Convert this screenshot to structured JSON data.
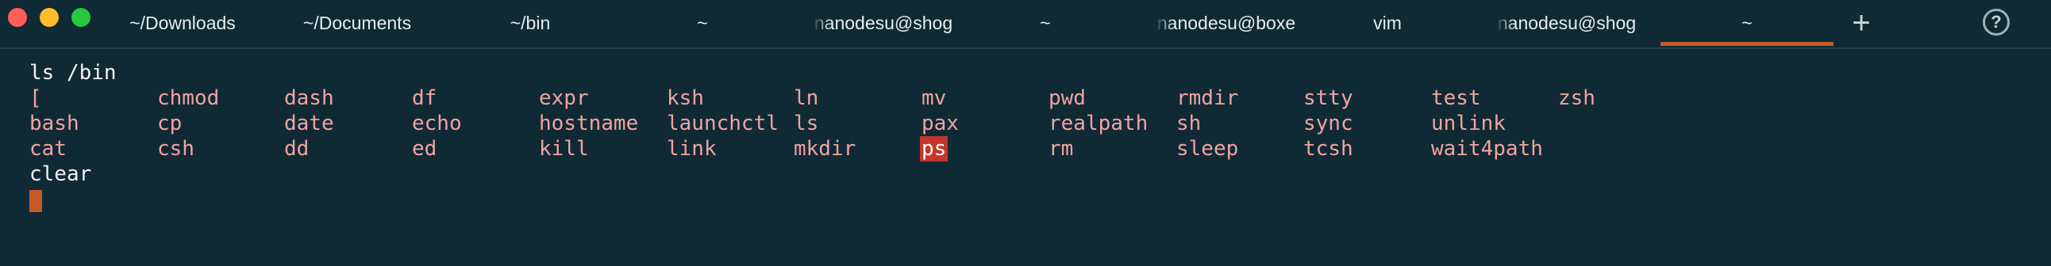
{
  "window": {
    "tabs": [
      {
        "label": "~/Downloads",
        "active": false
      },
      {
        "label": "~/Documents",
        "active": false
      },
      {
        "label": "~/bin",
        "active": false
      },
      {
        "label": "~",
        "active": false
      },
      {
        "label": "nanodesu@shog",
        "active": false
      },
      {
        "label": "~",
        "active": false
      },
      {
        "label": "nanodesu@boxe",
        "active": false
      },
      {
        "label": "vim",
        "active": false
      },
      {
        "label": "nanodesu@shog",
        "active": false
      },
      {
        "label": "~",
        "active": true
      }
    ],
    "new_tab_label": "+",
    "help_label": "?",
    "accent": "#c45a24"
  },
  "terminal": {
    "command": "ls /bin",
    "rows": [
      [
        "[",
        "chmod",
        "dash",
        "df",
        "expr",
        "ksh",
        "ln",
        "mv",
        "pwd",
        "rmdir",
        "stty",
        "test",
        "zsh"
      ],
      [
        "bash",
        "cp",
        "date",
        "echo",
        "hostname",
        "launchctl",
        "ls",
        "pax",
        "realpath",
        "sh",
        "sync",
        "unlink",
        ""
      ],
      [
        "cat",
        "csh",
        "dd",
        "ed",
        "kill",
        "link",
        "mkdir",
        "ps",
        "rm",
        "sleep",
        "tcsh",
        "wait4path",
        ""
      ]
    ],
    "last_line": "clear",
    "highlighted": "ps",
    "colors": {
      "background": "#0f2a35",
      "entry": "#f2a2a0",
      "highlight": "#c4362b",
      "cursor": "#c45a24"
    }
  }
}
